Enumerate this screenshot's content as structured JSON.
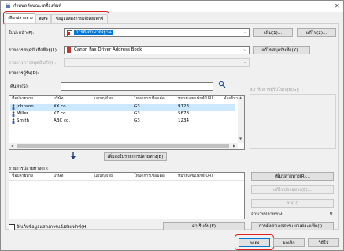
{
  "window": {
    "title": "กำหนดลักษณะเครื่องพิมพ์"
  },
  "tabs": [
    {
      "label": "เลือกปลายทาง"
    },
    {
      "label": "พิเศษ"
    },
    {
      "label": "ข้อมูลแสดงการแจ้งส่งแฟกซ์"
    }
  ],
  "cover": {
    "label": "ใบปะหน้า(P):",
    "value": "การตั้งค่ามาตรฐาน",
    "btn_add": "เพิ่ม(1)...",
    "btn_edit": "แก้ไข(2)..."
  },
  "addressbook": {
    "label": "รายการสมุดบันทึกที่อยู่(L):",
    "value": "Canon Fax Driver Address Book",
    "btn_edit_book": "แก้ไขสมุดบันทึก(K)..."
  },
  "search_section": {
    "search_scope_label": "รายการการสมุดบันทึก(I):",
    "group_label": "รายการผู้รับ(D):",
    "search_label": "ค้นหา(S):",
    "search_value": "",
    "list_label": "สมาชิกการผู้รับในกลุ่ม(G):"
  },
  "recipients": {
    "columns": [
      "ชื่อปลายทาง",
      "บริษัท",
      "แผนก/ฝ่าย",
      "โหมดการเชื่อมต่อ",
      "หมายเลขแฟกซ์/URI",
      "คำอธิบาย"
    ],
    "rows": [
      {
        "name": "Johnson",
        "company": "XX co.",
        "dept": "",
        "mode": "G3",
        "number": "9123",
        "note": ""
      },
      {
        "name": "Miller",
        "company": "KZ co.",
        "dept": "",
        "mode": "G3",
        "number": "5678",
        "note": ""
      },
      {
        "name": "Smith",
        "company": "ABC co.",
        "dept": "",
        "mode": "G3",
        "number": "1234",
        "note": ""
      }
    ]
  },
  "add_to_list_btn": "เพิ่มลงในรายการปลายทาง(B)",
  "destination": {
    "label": "รายการปลายทาง(T):",
    "columns": [
      "ชื่อปลายทาง",
      "บริษัท",
      "แผนก/ฝ่าย",
      "โหมดการเชื่อมต่อ",
      "หมายเลขแฟกซ์/URI"
    ],
    "btn_add_dest": "เพิ่มปลายทาง(R)...",
    "btn_edit_dest": "แก้ไขปลายทาง(E)...",
    "btn_delete": "ลบ(U)",
    "count_label": "จำนวนปลายทาง:",
    "count_value": "0"
  },
  "bottom": {
    "checkbox_label": "จัดเก็บข้อมูลแสดงการแจ้งส่งแฟกซ์(H)",
    "btn_default": "ค่าเริ่มต้น(F)",
    "btn_setting": "การตั้งค่าเอกสารแยกแต่ละแฟ็ก(I)...",
    "btn_ok": "ตกลง",
    "btn_cancel": "ยกเลิก",
    "btn_help": "วิธีใช้"
  },
  "colors": {
    "highlight": "#e02020",
    "selected_row": "#cce8ff"
  }
}
